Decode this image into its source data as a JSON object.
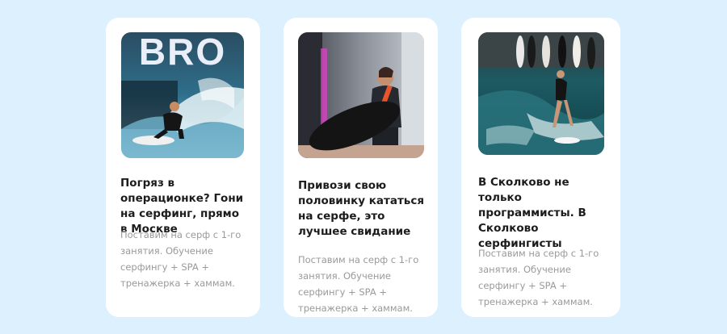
{
  "cards": [
    {
      "photo_logo_text": "BRO",
      "title": "Погряз в операционке? Гони на серфинг, прямо в Москве",
      "description": "Поставим на серф с 1-го занятия. Обучение серфингу + SPA + тренажерка + хаммам."
    },
    {
      "title": "Привози свою половинку кататься на серфе, это лучшее свидание",
      "description": "Поставим на серф с 1-го занятия. Обучение серфингу + SPA + тренажерка + хаммам."
    },
    {
      "title": "В Сколково не только программисты. В Сколково серфингисты",
      "description": "Поставим на серф с 1-го занятия. Обучение серфингу + SPA + тренажерка + хаммам."
    }
  ]
}
